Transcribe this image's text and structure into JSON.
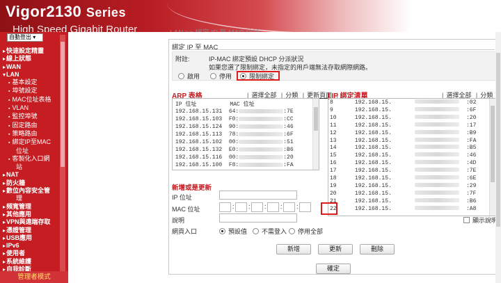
{
  "header": {
    "brand": "Vigor2130",
    "series": "Series",
    "tagline": "High Speed Gigabit Router",
    "hint": "LAN >> 綁定 IP 至 MAC 位址"
  },
  "sidebar": {
    "logout_label": "自動登出 ▾",
    "items": [
      {
        "label": "快速設定精靈",
        "kind": "top"
      },
      {
        "label": "線上狀態",
        "kind": "top"
      },
      {
        "label": "WAN",
        "kind": "top"
      },
      {
        "label": "LAN",
        "kind": "top"
      },
      {
        "label": "基本設定",
        "kind": "sub"
      },
      {
        "label": "埠號設定",
        "kind": "sub"
      },
      {
        "label": "MAC位址表格",
        "kind": "sub"
      },
      {
        "label": "VLAN",
        "kind": "sub"
      },
      {
        "label": "監控埠號",
        "kind": "sub"
      },
      {
        "label": "固定路由",
        "kind": "sub"
      },
      {
        "label": "策略路由",
        "kind": "sub"
      },
      {
        "label": "綁定IP至MAC",
        "kind": "sub"
      },
      {
        "label": "位址",
        "kind": "wrap"
      },
      {
        "label": "客製化入口網",
        "kind": "sub"
      },
      {
        "label": "站",
        "kind": "wrap"
      },
      {
        "label": "NAT",
        "kind": "top"
      },
      {
        "label": "防火牆",
        "kind": "top"
      },
      {
        "label": "數位內容安全管",
        "kind": "top"
      },
      {
        "label": "理",
        "kind": "wrap"
      },
      {
        "label": "頻寬管理",
        "kind": "top"
      },
      {
        "label": "其他應用",
        "kind": "top"
      },
      {
        "label": "VPN與遠端存取",
        "kind": "top"
      },
      {
        "label": "憑證管理",
        "kind": "top"
      },
      {
        "label": "USB應用",
        "kind": "top"
      },
      {
        "label": "IPv6",
        "kind": "top"
      },
      {
        "label": "使用者",
        "kind": "top"
      },
      {
        "label": "系統維護",
        "kind": "top"
      },
      {
        "label": "自我診斷",
        "kind": "top"
      }
    ],
    "admin_mode": "管理者模式"
  },
  "panel": {
    "title": "綁定 IP 至 MAC",
    "note_label": "附註:",
    "note_line1": "IP-MAC 綁定預設 DHCP 分派狀況",
    "note_line2": "如果您選了限制綁定，未指定的用戶端無法存取網際網路。",
    "options": {
      "enable": "啟用",
      "disable": "停用",
      "strict": "限制綁定"
    }
  },
  "arp": {
    "title": "ARP 表格",
    "select_all": "選擇全部",
    "sort": "分類",
    "refresh": "更新頁面",
    "header": "IP 位址          MAC 位址",
    "rows": [
      {
        "ip": "192.168.15.131",
        "mac_start": "64:",
        "mac_end": ":7E"
      },
      {
        "ip": "192.168.15.103",
        "mac_start": "F0:",
        "mac_end": ":CC"
      },
      {
        "ip": "192.168.15.124",
        "mac_start": "90:",
        "mac_end": ":46"
      },
      {
        "ip": "192.168.15.113",
        "mac_start": "78:",
        "mac_end": ":6F"
      },
      {
        "ip": "192.168.15.102",
        "mac_start": "00:",
        "mac_end": ":51"
      },
      {
        "ip": "192.168.15.132",
        "mac_start": "E0:",
        "mac_end": ":B6"
      },
      {
        "ip": "192.168.15.116",
        "mac_start": "00:",
        "mac_end": ":20"
      },
      {
        "ip": "192.168.15.100",
        "mac_start": "F8:",
        "mac_end": ":FA"
      }
    ]
  },
  "bind": {
    "title": "IP 綁定清單",
    "select_all": "選擇全部",
    "sort": "分類",
    "rows": [
      {
        "idx": "8",
        "ip": "192.168.15.",
        "mac_end": ":02"
      },
      {
        "idx": "9",
        "ip": "192.168.15.",
        "mac_end": ":6F"
      },
      {
        "idx": "10",
        "ip": "192.168.15.",
        "mac_end": ":20"
      },
      {
        "idx": "11",
        "ip": "192.168.15.",
        "mac_end": ":17"
      },
      {
        "idx": "12",
        "ip": "192.168.15.",
        "mac_end": ":B9"
      },
      {
        "idx": "13",
        "ip": "192.168.15.",
        "mac_end": ":FA"
      },
      {
        "idx": "14",
        "ip": "192.168.15.",
        "mac_end": ":B5"
      },
      {
        "idx": "15",
        "ip": "192.168.15.",
        "mac_end": ":46"
      },
      {
        "idx": "16",
        "ip": "192.168.15.",
        "mac_end": ":4D"
      },
      {
        "idx": "17",
        "ip": "192.168.15.",
        "mac_end": ":7E"
      },
      {
        "idx": "18",
        "ip": "192.168.15.",
        "mac_end": ":6E"
      },
      {
        "idx": "19",
        "ip": "192.168.15.",
        "mac_end": ":29"
      },
      {
        "idx": "20",
        "ip": "192.168.15.",
        "mac_end": ":7F"
      },
      {
        "idx": "21",
        "ip": "192.168.15.",
        "mac_end": ":B6"
      },
      {
        "idx": "22",
        "ip": "192.168.15.",
        "mac_end": ":A8"
      }
    ],
    "show_desc": "顯示說明"
  },
  "form": {
    "title": "新增或是更新",
    "ip_label": "IP 位址",
    "mac_label": "MAC 位址",
    "desc_label": "說明",
    "page_label": "網頁入口",
    "page_options": {
      "default": "預設值",
      "no_login": "不需登入",
      "disable_all": "停用全部"
    }
  },
  "buttons": {
    "add": "新增",
    "update": "更新",
    "delete": "刪除",
    "ok": "確定"
  }
}
